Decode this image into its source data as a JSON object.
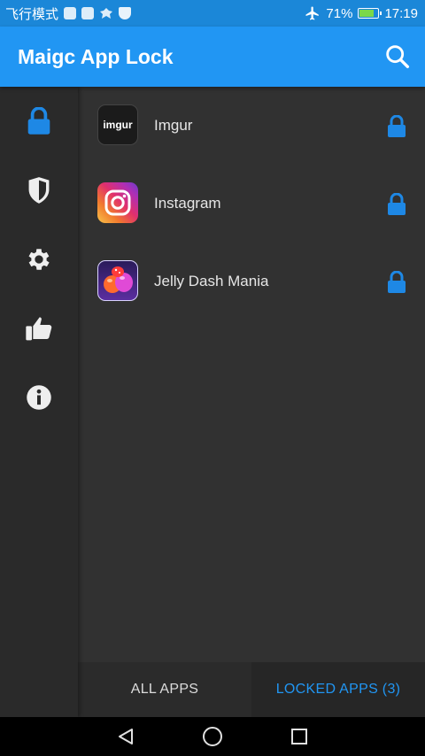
{
  "status_bar": {
    "mode_text": "飞行模式",
    "battery_percent": "71%",
    "time": "17:19",
    "battery_level": 0.71,
    "icons": [
      "notification-icon",
      "notification-icon",
      "game-icon",
      "shield-notification-icon",
      "airplane-icon",
      "battery-icon"
    ]
  },
  "app_bar": {
    "title": "Maigc App Lock",
    "search_icon": "search-icon"
  },
  "sidebar": {
    "items": [
      {
        "name": "lock",
        "icon": "lock-icon",
        "active": true
      },
      {
        "name": "shield",
        "icon": "shield-icon",
        "active": false
      },
      {
        "name": "settings",
        "icon": "gear-icon",
        "active": false
      },
      {
        "name": "rate",
        "icon": "thumbs-up-icon",
        "active": false
      },
      {
        "name": "info",
        "icon": "info-icon",
        "active": false
      }
    ]
  },
  "apps": [
    {
      "name": "Imgur",
      "icon_text": "imgur",
      "locked": true
    },
    {
      "name": "Instagram",
      "locked": true
    },
    {
      "name": "Jelly Dash Mania",
      "locked": true
    }
  ],
  "tabs": {
    "all_label": "ALL APPS",
    "locked_label": "LOCKED APPS (3)",
    "selected": "locked"
  },
  "colors": {
    "accent": "#2196f3",
    "status_bar": "#1b87d8",
    "background": "#313131",
    "sidebar": "#2a2a2a",
    "inactive_icon": "#eeeeee"
  }
}
